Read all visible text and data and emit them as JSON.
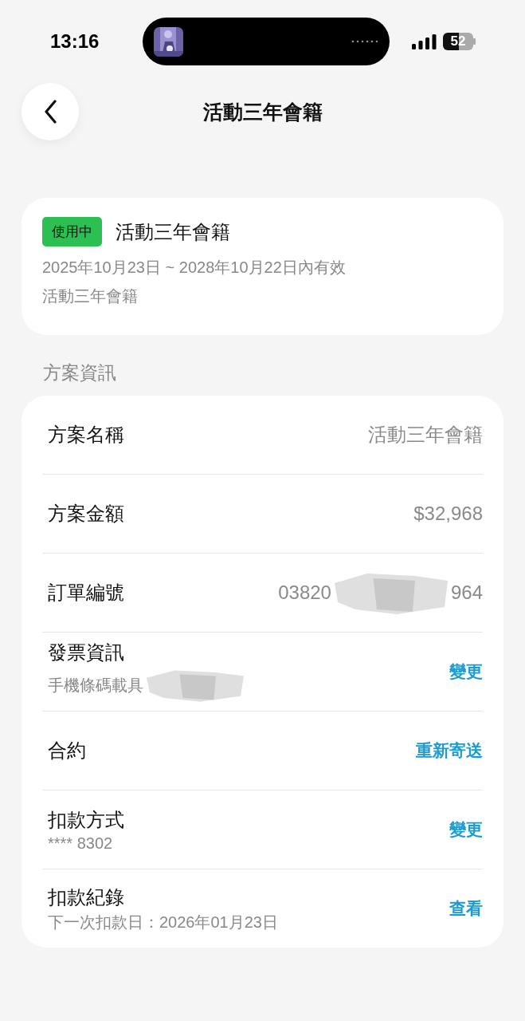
{
  "status_bar": {
    "time": "13:16",
    "battery": "52"
  },
  "header": {
    "title": "活動三年會籍"
  },
  "membership": {
    "status": "使用中",
    "active": true,
    "name": "活動三年會籍",
    "period": "2025年10月23日 ~ 2028年10月22日內有效",
    "note": "活動三年會籍"
  },
  "section": {
    "title": "方案資訊"
  },
  "rows": [
    {
      "kind": "value",
      "label": "方案名稱",
      "value": "活動三年會籍"
    },
    {
      "kind": "value",
      "label": "方案金額",
      "value": "$32,968"
    },
    {
      "kind": "redacted_value",
      "label": "訂單編號",
      "value_start": "03820",
      "value_end": "964"
    },
    {
      "kind": "action",
      "label": "發票資訊",
      "subtitle": "手機條碼載具",
      "subtitle_redacted": true,
      "action": "變更"
    },
    {
      "kind": "action",
      "label": "合約",
      "action": "重新寄送"
    },
    {
      "kind": "action",
      "label": "扣款方式",
      "subtitle": "**** 8302",
      "action": "變更"
    },
    {
      "kind": "action",
      "label": "扣款紀錄",
      "subtitle": "下一次扣款日：2026年01月23日",
      "action": "查看"
    }
  ]
}
